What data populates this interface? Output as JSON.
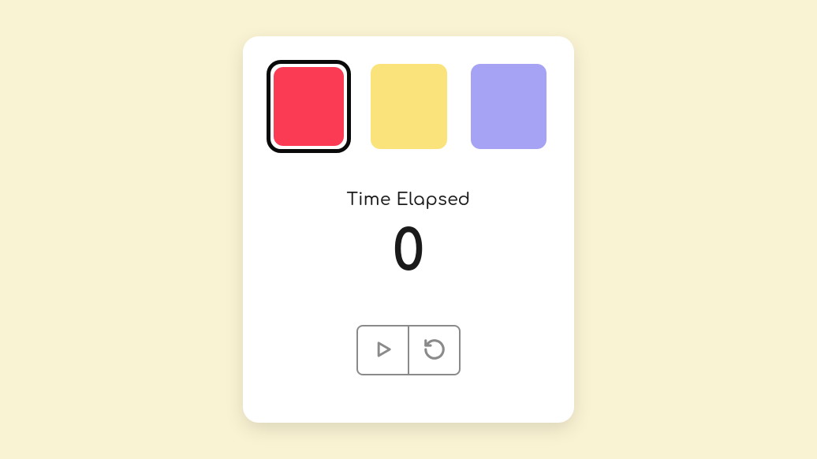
{
  "swatches": [
    {
      "color": "#fb3a53",
      "selected": true
    },
    {
      "color": "#fbe37b",
      "selected": false
    },
    {
      "color": "#a6a3f5",
      "selected": false
    }
  ],
  "timer": {
    "label": "Time Elapsed",
    "value": "0"
  },
  "icons": {
    "play": "play-icon",
    "reset": "reset-icon"
  }
}
